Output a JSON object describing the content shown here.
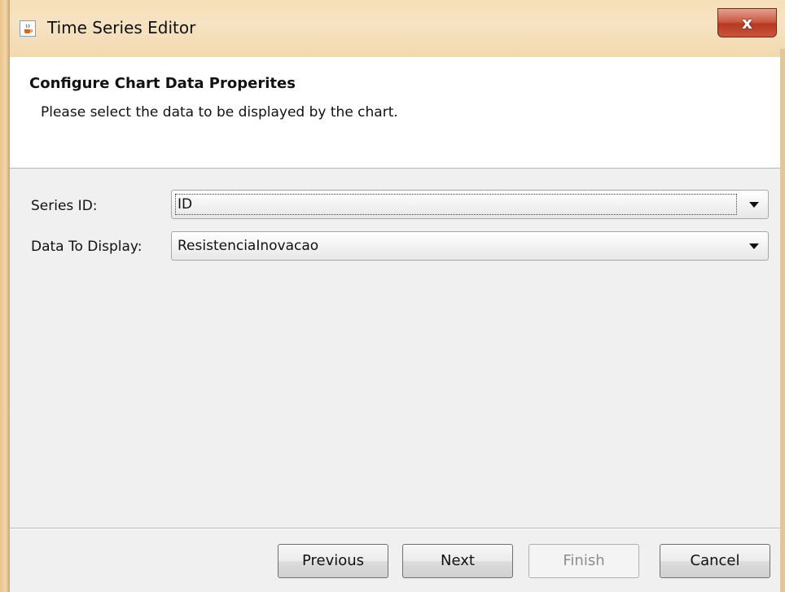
{
  "window": {
    "title": "Time Series Editor",
    "close_symbol": "x"
  },
  "header": {
    "title": "Configure Chart Data Properites",
    "description": "Please select the data to be displayed by the chart."
  },
  "form": {
    "series_id": {
      "label": "Series ID:",
      "value": "ID"
    },
    "data_to_display": {
      "label": "Data To Display:",
      "value": "ResistenciaInovacao"
    }
  },
  "buttons": {
    "previous": "Previous",
    "next": "Next",
    "finish": "Finish",
    "cancel": "Cancel"
  },
  "icons": {
    "app": "java-cup-icon",
    "close": "close-icon",
    "dropdown": "chevron-down-icon"
  }
}
